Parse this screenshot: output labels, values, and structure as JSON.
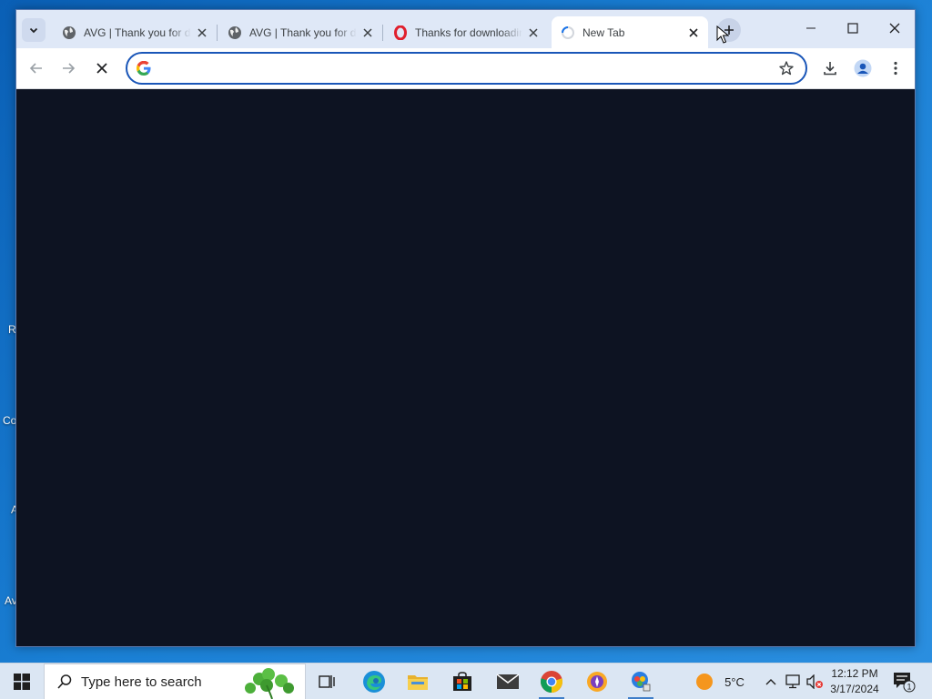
{
  "browser": {
    "tabs": [
      {
        "title": "AVG | Thank you for downloading",
        "icon": "globe-icon",
        "active": false
      },
      {
        "title": "AVG | Thank you for downloading",
        "icon": "globe-icon",
        "active": false
      },
      {
        "title": "Thanks for downloading Opera",
        "icon": "opera-icon",
        "active": false
      },
      {
        "title": "New Tab",
        "icon": "loading-spinner-icon",
        "active": true
      }
    ],
    "omnibox": {
      "value": "",
      "placeholder": ""
    },
    "content_bg": "#0d1322"
  },
  "desktop": {
    "fragments": [
      "R",
      "Co",
      "A",
      "Av"
    ]
  },
  "taskbar": {
    "search_placeholder": "Type here to search",
    "weather": {
      "temp": "5°C"
    },
    "clock": {
      "time": "12:12 PM",
      "date": "3/17/2024"
    },
    "notification_count": "1",
    "apps": [
      "task-view-icon",
      "edge-icon",
      "file-explorer-icon",
      "store-icon",
      "mail-icon",
      "chrome-icon",
      "avast-browser-icon",
      "avg-installer-icon"
    ]
  }
}
